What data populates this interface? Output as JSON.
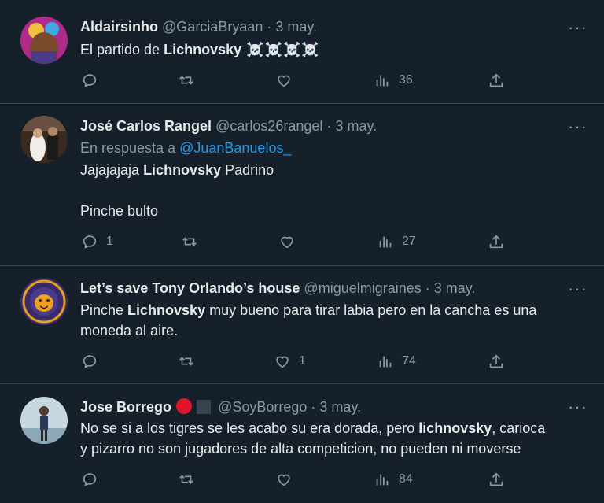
{
  "tweets": [
    {
      "name": "Aldairsinho",
      "handle": "@GarciaBryaan",
      "dot": "·",
      "date": "3 may.",
      "text_prefix": "El partido de ",
      "text_bold": "Lichnovsky",
      "text_suffix": " ☠️☠️☠️☠️",
      "reply_count": "",
      "retweet_count": "",
      "like_count": "",
      "views": "36"
    },
    {
      "name": "José Carlos Rangel",
      "handle": "@carlos26rangel",
      "dot": "·",
      "date": "3 may.",
      "reply_to_label": "En respuesta a ",
      "reply_to_handle": "@JuanBanuelos_",
      "line1_prefix": "Jajajajaja ",
      "line1_bold": "Lichnovsky",
      "line1_suffix": " Padrino",
      "line2": "Pinche bulto",
      "reply_count": "1",
      "retweet_count": "",
      "like_count": "",
      "views": "27"
    },
    {
      "name": "Let’s save Tony Orlando’s house",
      "handle": "@miguelmigraines",
      "dot": "·",
      "date": "3 may.",
      "line1_prefix": "Pinche ",
      "line1_bold": "Lichnovsky",
      "line1_suffix": " muy bueno para tirar labia pero en la cancha es una",
      "line2": "moneda al aire.",
      "reply_count": "",
      "retweet_count": "",
      "like_count": "1",
      "views": "74"
    },
    {
      "name": "Jose Borrego",
      "handle": "@SoyBorrego",
      "dot": "·",
      "date": "3 may.",
      "line1_prefix": "No se si a los tigres se les acabo su era dorada, pero ",
      "line1_bold": "lichnovsky",
      "line1_suffix": ", carioca",
      "line2": "y pizarro no son jugadores de alta competicion, no pueden ni moverse",
      "reply_count": "",
      "retweet_count": "",
      "like_count": "",
      "views": "84"
    }
  ],
  "icons": {
    "reply": "reply-icon",
    "retweet": "retweet-icon",
    "like": "heart-icon",
    "views": "views-icon",
    "share": "share-icon",
    "more": "more-icon"
  },
  "colors": {
    "background": "#15202b",
    "text": "#e7e9ea",
    "secondary": "#8b98a5",
    "link": "#1d9bf0",
    "divider": "#38444d"
  }
}
